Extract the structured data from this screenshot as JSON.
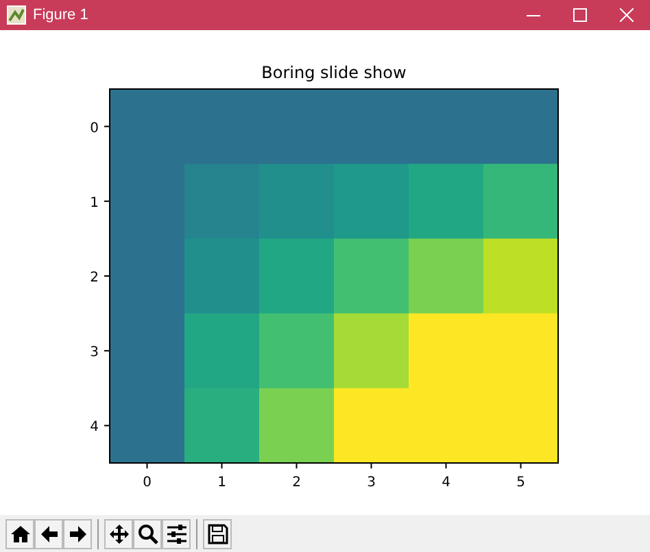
{
  "window": {
    "title": "Figure 1"
  },
  "plot": {
    "title": "Boring slide show",
    "xticks": [
      "0",
      "1",
      "2",
      "3",
      "4",
      "5"
    ],
    "yticks": [
      "0",
      "1",
      "2",
      "3",
      "4"
    ],
    "image": [
      [
        {
          "color": "#2c718e"
        },
        {
          "color": "#2c718e"
        },
        {
          "color": "#2c718e"
        },
        {
          "color": "#2c718e"
        },
        {
          "color": "#2c718e"
        },
        {
          "color": "#2c718e"
        }
      ],
      [
        {
          "color": "#2c718e"
        },
        {
          "color": "#25848e"
        },
        {
          "color": "#21908d"
        },
        {
          "color": "#1f9a8a"
        },
        {
          "color": "#22a785"
        },
        {
          "color": "#35b779"
        }
      ],
      [
        {
          "color": "#2c718e"
        },
        {
          "color": "#21908d"
        },
        {
          "color": "#22a785"
        },
        {
          "color": "#43bf71"
        },
        {
          "color": "#7ad151"
        },
        {
          "color": "#bddf26"
        }
      ],
      [
        {
          "color": "#2c718e"
        },
        {
          "color": "#22a785"
        },
        {
          "color": "#43bf71"
        },
        {
          "color": "#a5db36"
        },
        {
          "color": "#fde725"
        },
        {
          "color": "#fde725"
        }
      ],
      [
        {
          "color": "#2c718e"
        },
        {
          "color": "#29af7f"
        },
        {
          "color": "#7ad151"
        },
        {
          "color": "#fde725"
        },
        {
          "color": "#fde725"
        },
        {
          "color": "#fde725"
        }
      ]
    ]
  },
  "toolbar": [
    {
      "kind": "home"
    },
    {
      "kind": "back"
    },
    {
      "kind": "forward"
    },
    {
      "kind": "separator"
    },
    {
      "kind": "pan"
    },
    {
      "kind": "zoom"
    },
    {
      "kind": "configure"
    },
    {
      "kind": "separator"
    },
    {
      "kind": "save"
    }
  ]
}
